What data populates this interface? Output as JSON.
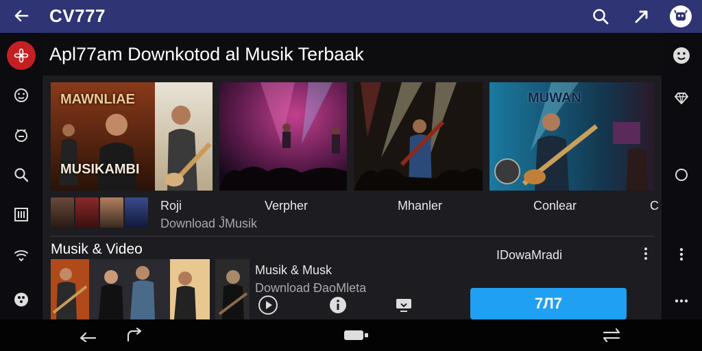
{
  "app": {
    "title": "CV777"
  },
  "header": {
    "heading": "Apl77am Downkotod al Musik Terbaak"
  },
  "cards": [
    {
      "label": "Roji",
      "sub": "Download ĴMusik",
      "poster_title": "MUSIKAMBI",
      "poster_top": "MAWNLIAE"
    },
    {
      "label": "Verpher"
    },
    {
      "label": "Mhanler"
    },
    {
      "label": "Conlear",
      "poster_title": "MUWAN"
    }
  ],
  "cards_more_label": "C",
  "section": {
    "title": "Musik & Video",
    "item_title": "Musik & Musk",
    "item_sub": "Download ĐaoMleta",
    "right_label": "IDowaMradi",
    "download_button": "7Л7"
  },
  "colors": {
    "appbar": "#2f3474",
    "accent": "#1fa0f2",
    "active": "#c41f22"
  },
  "icons": {
    "top": [
      "back-arrow-icon",
      "search-icon",
      "share-icon",
      "avatar-icon"
    ],
    "left": [
      "menu-icon",
      "emoji-icon",
      "mood-icon",
      "search-icon",
      "library-icon",
      "wifi-icon",
      "settings-icon"
    ],
    "right": [
      "smiley-icon",
      "heart-icon",
      "circle-icon",
      "more-vert-icon",
      "more-horiz-icon"
    ],
    "nav": [
      "nav-back-icon",
      "nav-return-icon",
      "nav-home-icon",
      "nav-recents-icon"
    ]
  }
}
